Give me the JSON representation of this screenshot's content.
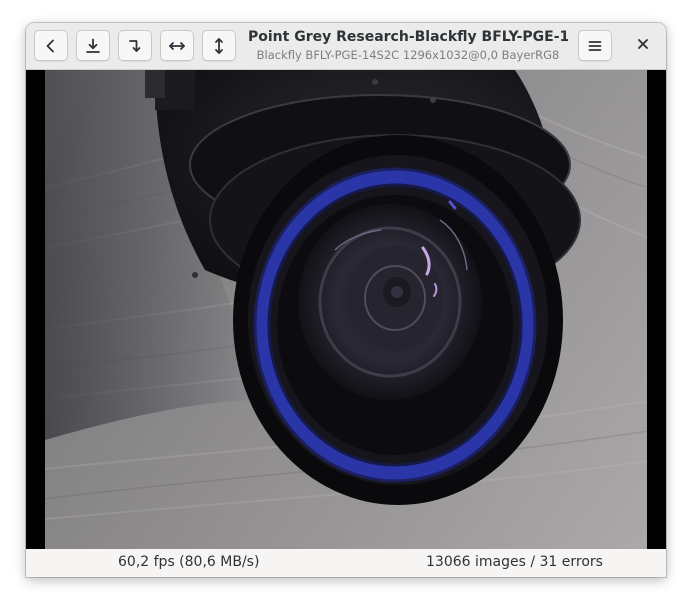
{
  "window": {
    "title": "Point Grey Research-Blackfly BFLY-PGE-1...",
    "subtitle": "Blackfly BFLY-PGE-14S2C 1296x1032@0,0 BayerRG8"
  },
  "toolbar": {
    "back_icon": "chevron-left-icon",
    "download_icon": "download-icon",
    "rotate_icon": "rotate-icon",
    "flip_horizontal_icon": "flip-horizontal-icon",
    "flip_vertical_icon": "flip-vertical-icon",
    "menu_icon": "hamburger-menu-icon",
    "close_icon": "close-icon"
  },
  "video": {
    "description_icon": "camera-frame"
  },
  "status": {
    "framerate": "60,2 fps (80,6 MB/s)",
    "counts": "13066 images / 31 errors"
  }
}
